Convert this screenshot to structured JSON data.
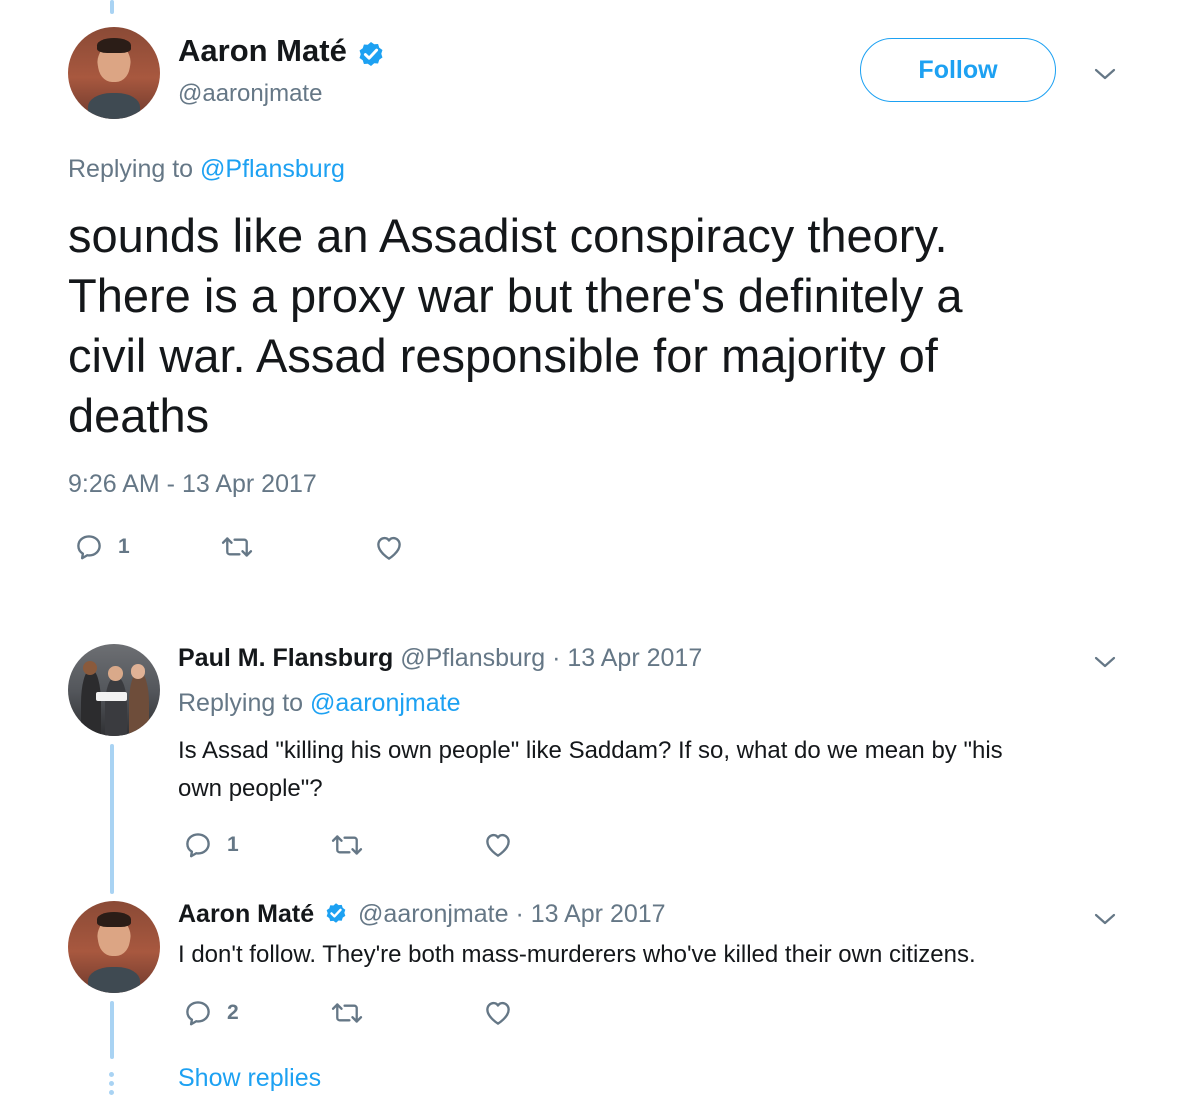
{
  "main_tweet": {
    "display_name": "Aaron Maté",
    "handle": "@aaronjmate",
    "follow_label": "Follow",
    "replying_prefix": "Replying to",
    "replying_to": "@Pflansburg",
    "text_lines": [
      "sounds like an Assadist conspiracy theory.",
      "There is a proxy war but there's definitely a",
      "civil war. Assad responsible for majority of",
      "deaths"
    ],
    "timestamp": "9:26 AM - 13 Apr 2017",
    "reply_count": "1"
  },
  "reply1": {
    "display_name": "Paul M. Flansburg",
    "handle": "@Pflansburg",
    "date": "· 13 Apr 2017",
    "replying_prefix": "Replying to",
    "replying_to": "@aaronjmate",
    "text_lines": [
      "Is Assad \"killing his own people\" like Saddam? If so, what do we mean by \"his",
      "own people\"?"
    ],
    "reply_count": "1"
  },
  "reply2": {
    "display_name": "Aaron Maté",
    "handle": "@aaronjmate",
    "date": "· 13 Apr 2017",
    "text": "I don't follow. They're both mass-murderers who've killed their own citizens.",
    "reply_count": "2"
  },
  "show_replies_label": "Show replies",
  "icons": [
    "verified-badge-icon",
    "chevron-down-icon",
    "reply-icon",
    "retweet-icon",
    "like-icon",
    "more-dots-icon"
  ],
  "colors": {
    "accent": "#1da1f2",
    "muted": "#657786",
    "text": "#14171a",
    "thread_line": "#a9d3f3"
  }
}
